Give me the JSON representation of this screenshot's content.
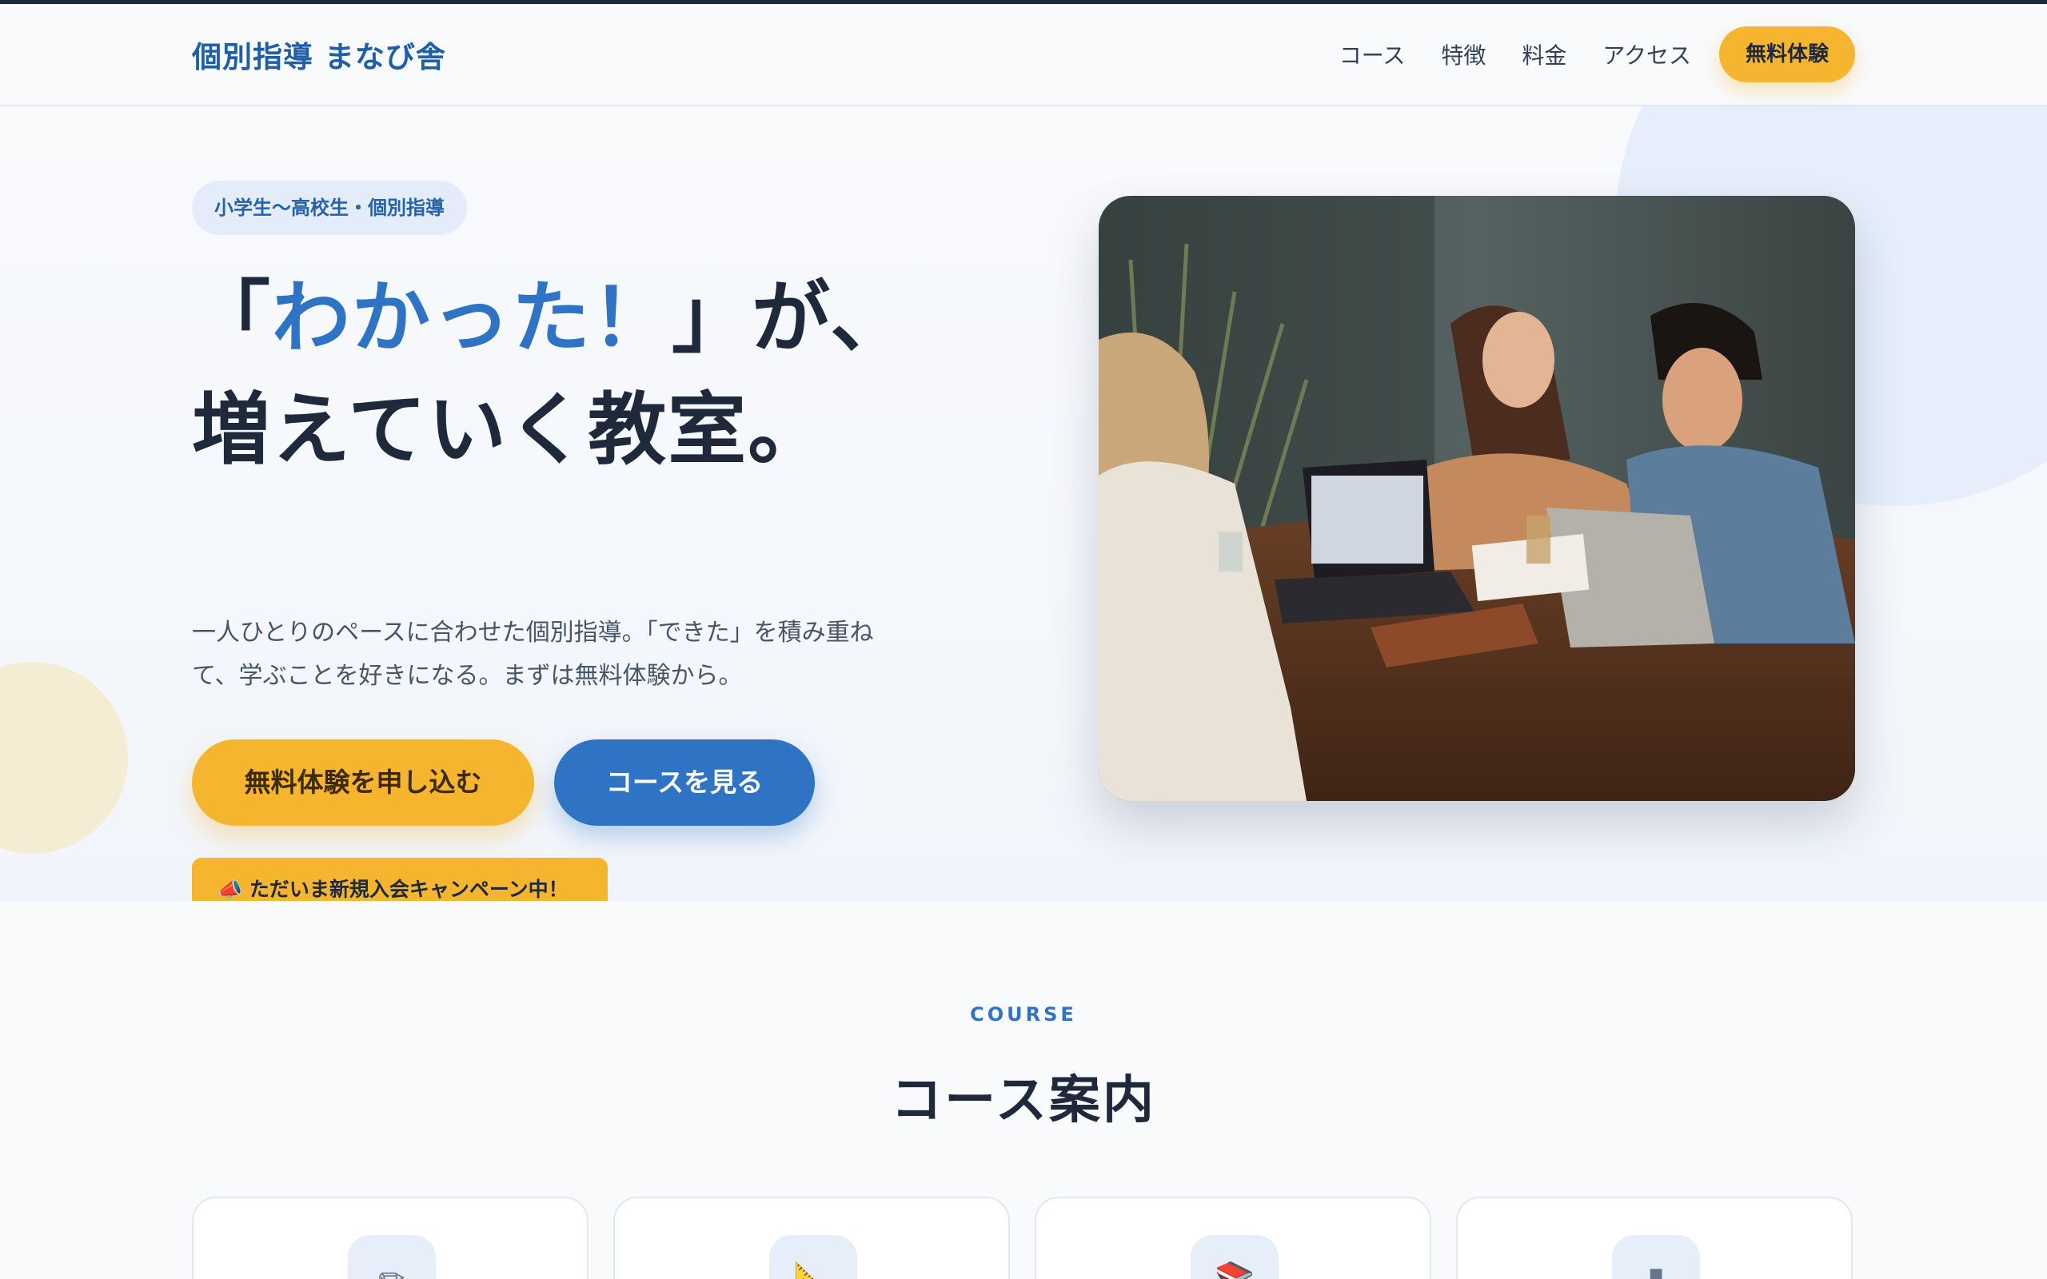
{
  "header": {
    "logo": "個別指導 まなび舎",
    "nav": [
      "コース",
      "特徴",
      "料金",
      "アクセス"
    ],
    "cta": "無料体験"
  },
  "hero": {
    "badge": "小学生〜高校生・個別指導",
    "title_open": "「",
    "title_highlight": "わかった！",
    "title_rest1": "」が、",
    "title_line2": "増えていく教室。",
    "lead": "一人ひとりのペースに合わせた個別指導。「できた」を積み重ねて、学ぶことを好きになる。まずは無料体験から。",
    "primary_button": "無料体験を申し込む",
    "secondary_button": "コースを見る",
    "campaign": "📣 ただいま新規入会キャンペーン中！"
  },
  "course_section": {
    "label": "COURSE",
    "title": "コース案内",
    "cards": [
      {
        "icon": "pencil-icon",
        "glyph": "✏"
      },
      {
        "icon": "ruler-icon",
        "glyph": "📐"
      },
      {
        "icon": "books-icon",
        "glyph": "📚"
      },
      {
        "icon": "tablet-icon",
        "glyph": "▮"
      }
    ]
  },
  "colors": {
    "brand_blue": "#2f74c4",
    "accent_yellow": "#f5b52f",
    "text_dark": "#1e293b"
  }
}
